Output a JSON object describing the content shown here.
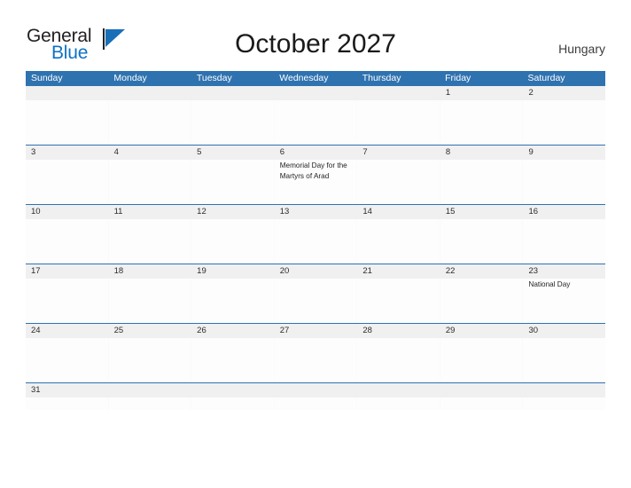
{
  "brand": {
    "name_part1": "General",
    "name_part2": "Blue",
    "logo_icon": "triangle-flag-icon",
    "accent_color": "#0f72c4"
  },
  "header": {
    "title": "October 2027",
    "country": "Hungary"
  },
  "theme": {
    "header_blue": "#2f72b0",
    "row_divider_blue": "#2f72b0",
    "date_band_gray": "#f0f0f0",
    "cell_white": "#fdfdfd",
    "text_dark": "#1f1f1f"
  },
  "calendar": {
    "month": "October",
    "year": "2027",
    "weekday_headers": [
      "Sunday",
      "Monday",
      "Tuesday",
      "Wednesday",
      "Thursday",
      "Friday",
      "Saturday"
    ],
    "weeks": [
      {
        "days": [
          {
            "date": "",
            "events": []
          },
          {
            "date": "",
            "events": []
          },
          {
            "date": "",
            "events": []
          },
          {
            "date": "",
            "events": []
          },
          {
            "date": "",
            "events": []
          },
          {
            "date": "1",
            "events": []
          },
          {
            "date": "2",
            "events": []
          }
        ]
      },
      {
        "days": [
          {
            "date": "3",
            "events": []
          },
          {
            "date": "4",
            "events": []
          },
          {
            "date": "5",
            "events": []
          },
          {
            "date": "6",
            "events": [
              "Memorial Day for the Martyrs of Arad"
            ]
          },
          {
            "date": "7",
            "events": []
          },
          {
            "date": "8",
            "events": []
          },
          {
            "date": "9",
            "events": []
          }
        ]
      },
      {
        "days": [
          {
            "date": "10",
            "events": []
          },
          {
            "date": "11",
            "events": []
          },
          {
            "date": "12",
            "events": []
          },
          {
            "date": "13",
            "events": []
          },
          {
            "date": "14",
            "events": []
          },
          {
            "date": "15",
            "events": []
          },
          {
            "date": "16",
            "events": []
          }
        ]
      },
      {
        "days": [
          {
            "date": "17",
            "events": []
          },
          {
            "date": "18",
            "events": []
          },
          {
            "date": "19",
            "events": []
          },
          {
            "date": "20",
            "events": []
          },
          {
            "date": "21",
            "events": []
          },
          {
            "date": "22",
            "events": []
          },
          {
            "date": "23",
            "events": [
              "National Day"
            ]
          }
        ]
      },
      {
        "days": [
          {
            "date": "24",
            "events": []
          },
          {
            "date": "25",
            "events": []
          },
          {
            "date": "26",
            "events": []
          },
          {
            "date": "27",
            "events": []
          },
          {
            "date": "28",
            "events": []
          },
          {
            "date": "29",
            "events": []
          },
          {
            "date": "30",
            "events": []
          }
        ]
      },
      {
        "short": true,
        "days": [
          {
            "date": "31",
            "events": []
          },
          {
            "date": "",
            "events": []
          },
          {
            "date": "",
            "events": []
          },
          {
            "date": "",
            "events": []
          },
          {
            "date": "",
            "events": []
          },
          {
            "date": "",
            "events": []
          },
          {
            "date": "",
            "events": []
          }
        ]
      }
    ]
  }
}
